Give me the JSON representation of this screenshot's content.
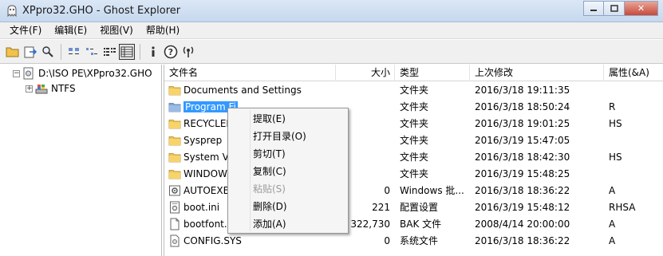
{
  "window": {
    "title": "XPpro32.GHO - Ghost Explorer",
    "minimize_icon": "minimize-icon",
    "maximize_icon": "maximize-icon",
    "close_glyph": "✕"
  },
  "menu": [
    {
      "label": "文件(F)"
    },
    {
      "label": "编辑(E)"
    },
    {
      "label": "视图(V)"
    },
    {
      "label": "帮助(H)"
    }
  ],
  "toolbar": [
    {
      "icon": "open-folder-icon"
    },
    {
      "icon": "extract-icon"
    },
    {
      "icon": "search-icon"
    },
    {
      "icon": "large-icons-view-icon"
    },
    {
      "icon": "small-icons-view-icon"
    },
    {
      "icon": "list-view-icon"
    },
    {
      "icon": "details-view-icon",
      "active": true
    },
    {
      "icon": "info-icon"
    },
    {
      "icon": "help-icon"
    },
    {
      "icon": "antenna-icon"
    }
  ],
  "tree": {
    "root_label": "D:\\ISO PE\\XPpro32.GHO",
    "child_label": "NTFS"
  },
  "columns": {
    "name": "文件名",
    "size": "大小",
    "type": "类型",
    "modified": "上次修改",
    "attr": "属性(&A)"
  },
  "rows": [
    {
      "name": "Documents and Settings",
      "size": "",
      "type": "文件夹",
      "modified": "2016/3/18 19:11:35",
      "attr": "",
      "icon": "folder-icon"
    },
    {
      "name": "Program Fi",
      "size": "",
      "type": "文件夹",
      "modified": "2016/3/18 18:50:24",
      "attr": "R",
      "icon": "folder-readonly-icon",
      "selected": true
    },
    {
      "name": "RECYCLER",
      "size": "",
      "type": "文件夹",
      "modified": "2016/3/18 19:01:25",
      "attr": "HS",
      "icon": "folder-icon"
    },
    {
      "name": "Sysprep",
      "size": "",
      "type": "文件夹",
      "modified": "2016/3/19 15:47:05",
      "attr": "",
      "icon": "folder-icon"
    },
    {
      "name": "System V",
      "size": "",
      "type": "文件夹",
      "modified": "2016/3/18 18:42:30",
      "attr": "HS",
      "icon": "folder-icon"
    },
    {
      "name": "WINDOW",
      "size": "",
      "type": "文件夹",
      "modified": "2016/3/19 15:48:25",
      "attr": "",
      "icon": "folder-icon"
    },
    {
      "name": "AUTOEXE",
      "size": "0",
      "type": "Windows 批...",
      "modified": "2016/3/18 18:36:22",
      "attr": "A",
      "icon": "batch-file-icon"
    },
    {
      "name": "boot.ini",
      "size": "221",
      "type": "配置设置",
      "modified": "2016/3/19 15:48:12",
      "attr": "RHSA",
      "icon": "settings-file-icon"
    },
    {
      "name": "bootfont.",
      "size": "322,730",
      "type": "BAK 文件",
      "modified": "2008/4/14 20:00:00",
      "attr": "A",
      "icon": "file-icon"
    },
    {
      "name": "CONFIG.SYS",
      "size": "0",
      "type": "系统文件",
      "modified": "2016/3/18 18:36:22",
      "attr": "A",
      "icon": "system-file-icon"
    }
  ],
  "context_menu": [
    {
      "label": "提取(E)",
      "enabled": true
    },
    {
      "label": "打开目录(O)",
      "enabled": true
    },
    {
      "label": "剪切(T)",
      "enabled": true
    },
    {
      "label": "复制(C)",
      "enabled": true
    },
    {
      "label": "粘贴(S)",
      "enabled": false
    },
    {
      "label": "删除(D)",
      "enabled": true
    },
    {
      "label": "添加(A)",
      "enabled": true
    }
  ],
  "colors": {
    "selection": "#3399ff",
    "folder": "#f2c24b",
    "title_bar": "#c6d8ef"
  }
}
